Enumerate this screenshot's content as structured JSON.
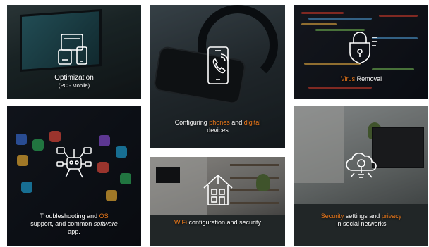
{
  "tiles": [
    {
      "id": "optimization",
      "title": "Optimization",
      "subtitle": "(PC - Mobile)"
    },
    {
      "id": "configuring",
      "parts": [
        "Configuring ",
        "phones",
        " and ",
        "digital",
        " devices"
      ]
    },
    {
      "id": "virus",
      "parts": [
        "Virus",
        " Removal"
      ]
    },
    {
      "id": "troubleshooting",
      "parts": [
        "Troubleshooting",
        " and ",
        "OS",
        " support, and common ",
        "software",
        " app."
      ]
    },
    {
      "id": "wifi",
      "parts": [
        "WiFi",
        " configuration",
        " and security"
      ]
    },
    {
      "id": "security",
      "parts": [
        "Security",
        " settings and ",
        "privacy",
        " in social networks"
      ]
    }
  ],
  "colors": {
    "accent": "#f07a1a",
    "text": "#ffffff"
  },
  "icons": [
    "devices-icon",
    "phone-call-icon",
    "lock-shield-icon",
    "robot-hub-icon",
    "smart-home-icon",
    "cloud-bulb-icon"
  ]
}
